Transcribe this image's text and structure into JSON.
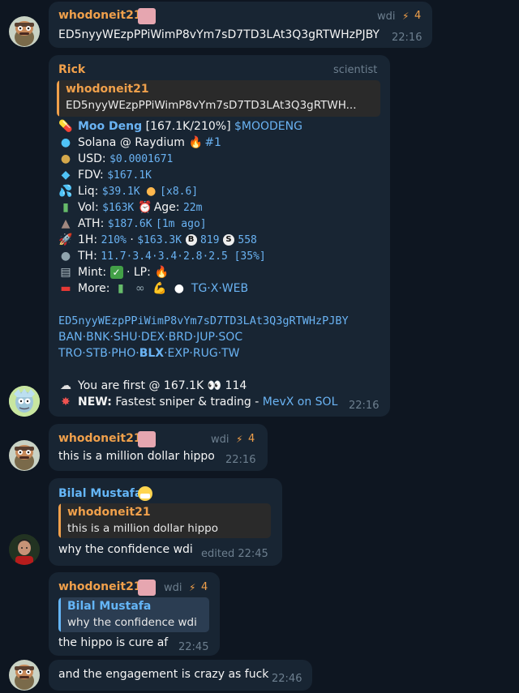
{
  "messages": {
    "m1": {
      "sender": "whodoneit21",
      "tag": "wdi",
      "badge": "4",
      "text": "ED5nyyWEzpPPiWimP8vYm7sD7TD3LAt3Q3gRTWHzPJBY",
      "time": "22:16"
    },
    "m2": {
      "sender": "Rick",
      "tag": "scientist",
      "reply_name": "whodoneit21",
      "reply_text": "ED5nyyWEzpPPiWimP8vYm7sD7TD3LAt3Q3gRTWH...",
      "token_name": "Moo Deng",
      "token_stats": "[167.1K/210%]",
      "ticker": "$MOODENG",
      "chain": "Solana @ Raydium",
      "rank": "#1",
      "usd_label": "USD:",
      "usd": "$0.0001671",
      "fdv_label": "FDV:",
      "fdv": "$167.1K",
      "liq_label": "Liq:",
      "liq": "$39.1K",
      "liq_mult": "[x8.6]",
      "vol_label": "Vol:",
      "vol": "$163K",
      "age_label": "Age:",
      "age": "22m",
      "ath_label": "ATH:",
      "ath": "$187.6K",
      "ath_ago": "[1m ago]",
      "h1_label": "1H:",
      "h1_pct": "210%",
      "h1_dot": "·",
      "h1_vol": "$163.3K",
      "buys": "819",
      "sells": "558",
      "th_label": "TH:",
      "th": "11.7·3.4·3.4·2.8·2.5 [35%]",
      "mint_label": "Mint:",
      "lp_label": "· LP:",
      "more_label": "More:",
      "more_links": "TG·X·WEB",
      "address": "ED5nyyWEzpPPiWimP8vYm7sD7TD3LAt3Q3gRTWHzPJBY",
      "links_row1": "BAN·BNK·SHU·DEX·BRD·JUP·SOC",
      "links_row2_a": "TRO·STB·PHO·",
      "links_row2_b": "BLX",
      "links_row2_c": "·EXP·RUG·TW",
      "first_text": "You are first @ 167.1K",
      "first_count": "114",
      "new_label": "NEW:",
      "new_text": "Fastest sniper & trading -",
      "new_link": "MevX on SOL",
      "time": "22:16"
    },
    "m3": {
      "sender": "whodoneit21",
      "tag": "wdi",
      "badge": "4",
      "text": "this is a million dollar hippo",
      "time": "22:16"
    },
    "m4": {
      "sender": "Bilal Mustafa",
      "reply_name": "whodoneit21",
      "reply_text": "this is a million dollar hippo",
      "text": "why the confidence wdi",
      "time": "edited 22:45"
    },
    "m5": {
      "sender": "whodoneit21",
      "tag": "wdi",
      "badge": "4",
      "reply_name": "Bilal Mustafa",
      "reply_text": "why the confidence wdi",
      "text": "the hippo is cure af",
      "time": "22:45"
    },
    "m6": {
      "text": "and the engagement is crazy as fuck",
      "time": "22:46"
    }
  },
  "colors": {
    "background": "#0e1621",
    "bubble": "#182533",
    "name_orange": "#f0a04b",
    "name_blue": "#64b5f6",
    "link": "#6ab3f3"
  }
}
